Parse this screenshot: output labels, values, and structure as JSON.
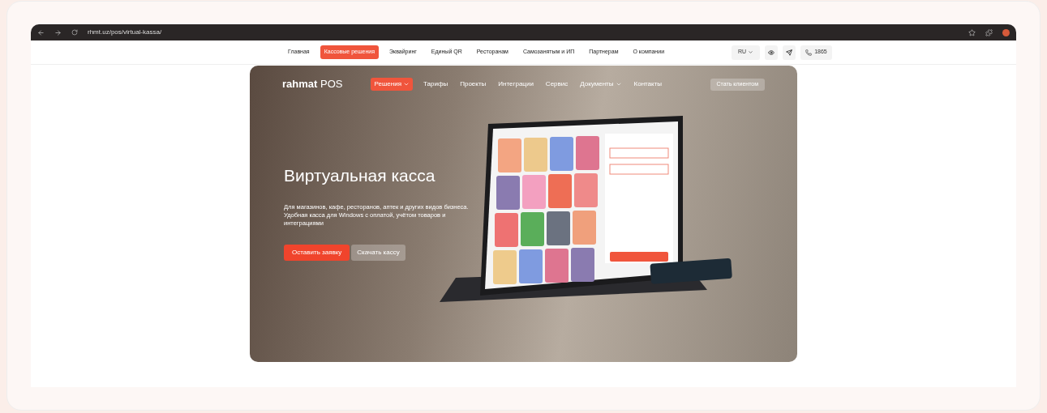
{
  "browser": {
    "url": "rhmt.uz/pos/virtual-kassa/"
  },
  "top_nav": {
    "items": [
      {
        "label": "Главная",
        "selected": false
      },
      {
        "label": "Кассовые решения",
        "selected": true
      },
      {
        "label": "Эквайринг",
        "selected": false
      },
      {
        "label": "Единый QR",
        "selected": false
      },
      {
        "label": "Ресторанам",
        "selected": false
      },
      {
        "label": "Самозанятым и ИП",
        "selected": false
      },
      {
        "label": "Партнерам",
        "selected": false
      },
      {
        "label": "О компании",
        "selected": false
      }
    ],
    "language": "RU",
    "phone": "1865"
  },
  "hero": {
    "logo_bold": "rahmat",
    "logo_light": "POS",
    "menu": [
      {
        "label": "Решения",
        "selected": true,
        "dropdown": true
      },
      {
        "label": "Тарифы",
        "selected": false,
        "dropdown": false
      },
      {
        "label": "Проекты",
        "selected": false,
        "dropdown": false
      },
      {
        "label": "Интеграции",
        "selected": false,
        "dropdown": false
      },
      {
        "label": "Сервис",
        "selected": false,
        "dropdown": false
      },
      {
        "label": "Документы",
        "selected": false,
        "dropdown": true
      },
      {
        "label": "Контакты",
        "selected": false,
        "dropdown": false
      }
    ],
    "cta": "Стать клиентом",
    "title": "Виртуальная касса",
    "description": "Для магазинов, кафе, ресторанов, аптек и других видов бизнеса. Удобная касса для Windows с оплатой, учётом товаров и интеграциями",
    "buttons": [
      {
        "label": "Оставить заявку",
        "kind": "primary"
      },
      {
        "label": "Скачать кассу",
        "kind": "secondary"
      }
    ]
  }
}
